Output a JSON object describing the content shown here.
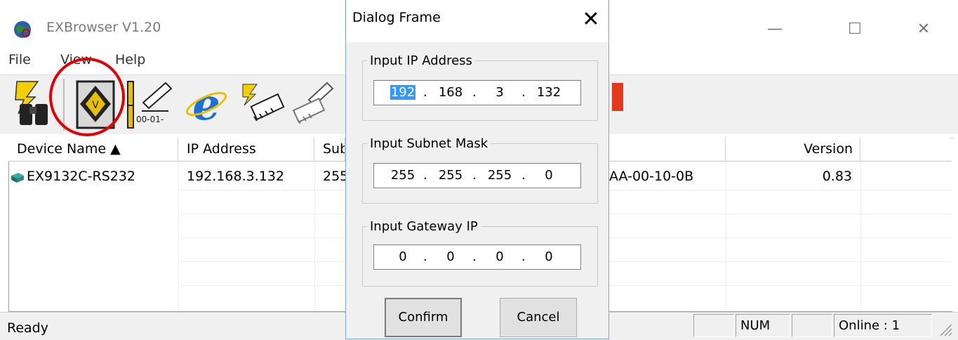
{
  "window": {
    "title": "EXBrowser V1.20",
    "minimize": "—",
    "maximize": "☐",
    "close": "✕"
  },
  "menu": [
    "File",
    "View",
    "Help"
  ],
  "toolbar": {
    "tools": [
      "search-network-icon",
      "config-ip-icon",
      "edit-id-icon",
      "web-browser-icon",
      "firmware-update-icon",
      "edit-config-icon",
      "exit-icon"
    ]
  },
  "list": {
    "columns": [
      "Device Name ▲",
      "IP Address",
      "Sub",
      "",
      "Version"
    ],
    "rows": [
      {
        "name": "EX9132C-RS232",
        "ip": "192.168.3.132",
        "subnet": "255",
        "mac": "AA-00-10-0B",
        "version": "0.83"
      }
    ]
  },
  "status": {
    "ready": "Ready",
    "panels": [
      "",
      "NUM",
      "",
      "Online : 1"
    ]
  },
  "dialog": {
    "title": "Dialog Frame",
    "close": "✕",
    "ip_group": {
      "label": "Input IP Address",
      "octets": [
        "192",
        "168",
        "3",
        "132"
      ]
    },
    "mask_group": {
      "label": "Input Subnet Mask",
      "octets": [
        "255",
        "255",
        "255",
        "0"
      ]
    },
    "gw_group": {
      "label": "Input Gateway IP",
      "octets": [
        "0",
        "0",
        "0",
        "0"
      ]
    },
    "confirm": "Confirm",
    "cancel": "Cancel"
  },
  "colors": {
    "highlight_circle": "#e30000",
    "selection": "#3399ff",
    "dialog_border": "#7aa6d6"
  }
}
